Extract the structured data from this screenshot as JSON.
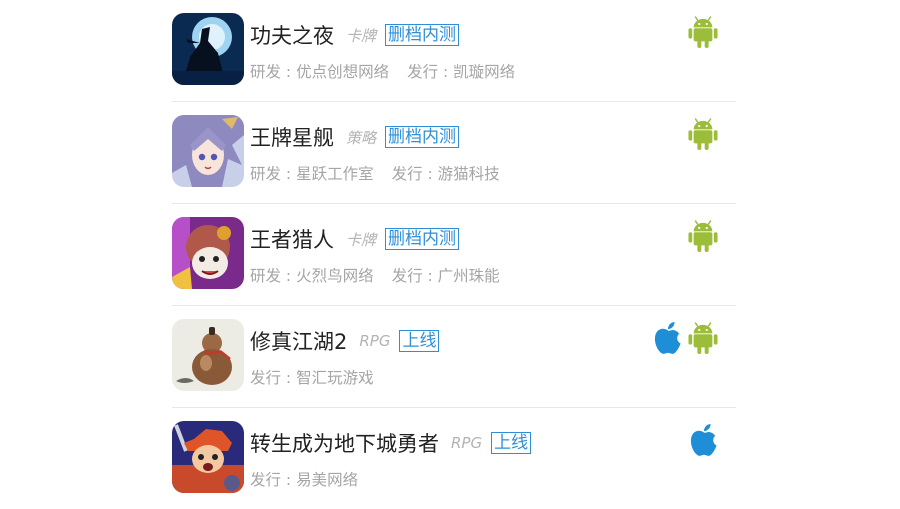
{
  "games": [
    {
      "name": "功夫之夜",
      "genre": "卡牌",
      "status": "删档内测",
      "developer_label": "研发 : 优点创想网络",
      "publisher_label": "发行 : 凯璇网络",
      "platforms": [
        "android"
      ],
      "icon": "kungfu-night-icon"
    },
    {
      "name": "王牌星舰",
      "genre": "策略",
      "status": "删档内测",
      "developer_label": "研发 : 星跃工作室",
      "publisher_label": "发行 : 游猫科技",
      "platforms": [
        "android"
      ],
      "icon": "ace-starship-icon"
    },
    {
      "name": "王者猎人",
      "genre": "卡牌",
      "status": "删档内测",
      "developer_label": "研发 : 火烈鸟网络",
      "publisher_label": "发行 : 广州珠能",
      "platforms": [
        "android"
      ],
      "icon": "king-hunter-icon"
    },
    {
      "name": "修真江湖2",
      "genre": "RPG",
      "status": "上线",
      "developer_label": "",
      "publisher_label": "发行 : 智汇玩游戏",
      "platforms": [
        "ios",
        "android"
      ],
      "icon": "gourd-icon"
    },
    {
      "name": "转生成为地下城勇者",
      "genre": "RPG",
      "status": "上线",
      "developer_label": "",
      "publisher_label": "发行 : 易美网络",
      "platforms": [
        "ios"
      ],
      "icon": "dungeon-hero-icon"
    }
  ],
  "colors": {
    "android": "#9bbd3a",
    "ios": "#1e8fd6",
    "status": "#2e8fd8"
  }
}
